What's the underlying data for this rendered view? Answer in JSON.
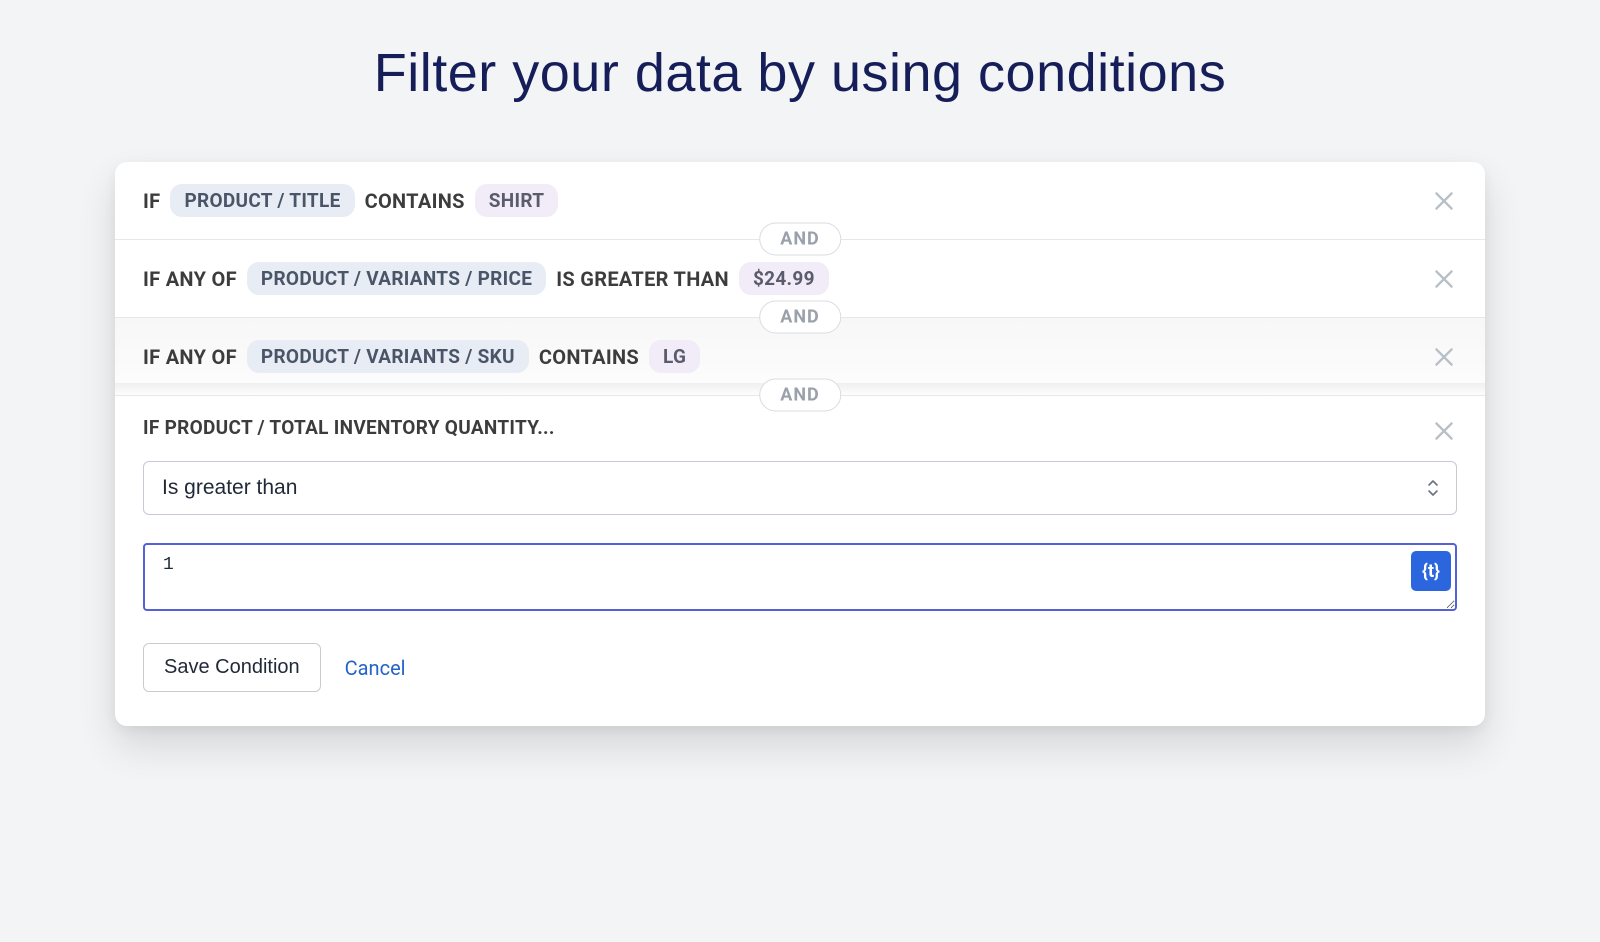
{
  "page": {
    "title": "Filter your data by using conditions"
  },
  "connector": "AND",
  "conditions": [
    {
      "prefix": "IF",
      "field": "PRODUCT / TITLE",
      "operator": "CONTAINS",
      "value": "SHIRT"
    },
    {
      "prefix": "IF ANY OF",
      "field": "PRODUCT / VARIANTS / PRICE",
      "operator": "IS GREATER THAN",
      "value": "$24.99"
    },
    {
      "prefix": "IF ANY OF",
      "field": "PRODUCT / VARIANTS / SKU",
      "operator": "CONTAINS",
      "value": "LG"
    }
  ],
  "edit": {
    "label": "IF PRODUCT / TOTAL INVENTORY QUANTITY...",
    "operator_selected": "Is greater than",
    "value": "1",
    "token_button": "{t}"
  },
  "actions": {
    "save": "Save Condition",
    "cancel": "Cancel"
  }
}
